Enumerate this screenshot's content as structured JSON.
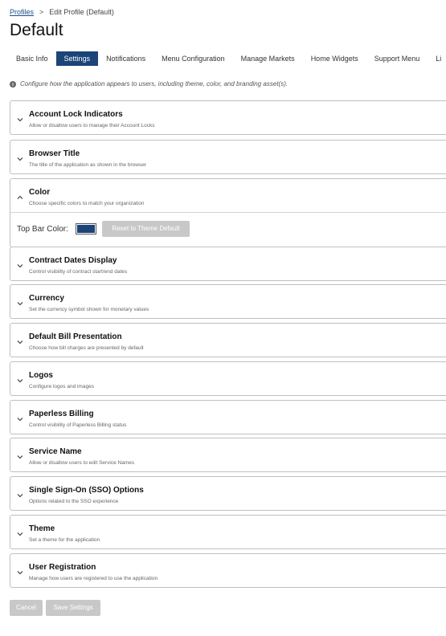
{
  "breadcrumb": {
    "root": "Profiles",
    "separator": ">",
    "current": "Edit Profile (Default)"
  },
  "title": "Default",
  "tabs": [
    {
      "label": "Basic Info",
      "active": false
    },
    {
      "label": "Settings",
      "active": true
    },
    {
      "label": "Notifications",
      "active": false
    },
    {
      "label": "Menu Configuration",
      "active": false
    },
    {
      "label": "Manage Markets",
      "active": false
    },
    {
      "label": "Home Widgets",
      "active": false
    },
    {
      "label": "Support Menu",
      "active": false
    },
    {
      "label": "Li",
      "active": false
    }
  ],
  "info_note": "Configure how the application appears to users, including theme, color, and branding asset(s).",
  "sections": [
    {
      "title": "Account Lock Indicators",
      "desc": "Allow or disallow users to manage their Account Locks",
      "expanded": false
    },
    {
      "title": "Browser Title",
      "desc": "The title of the application as shown in the browser",
      "expanded": false
    },
    {
      "title": "Color",
      "desc": "Choose specific colors to match your organization",
      "expanded": true
    },
    {
      "title": "Contract Dates Display",
      "desc": "Control visibility of contract start/end dates",
      "expanded": false
    },
    {
      "title": "Currency",
      "desc": "Set the currency symbol shown for monetary values",
      "expanded": false
    },
    {
      "title": "Default Bill Presentation",
      "desc": "Choose how bill charges are presented by default",
      "expanded": false
    },
    {
      "title": "Logos",
      "desc": "Configure logos and images",
      "expanded": false
    },
    {
      "title": "Paperless Billing",
      "desc": "Control visibility of Paperless Billing status",
      "expanded": false
    },
    {
      "title": "Service Name",
      "desc": "Allow or disallow users to edit Service Names",
      "expanded": false
    },
    {
      "title": "Single Sign-On (SSO) Options",
      "desc": "Options related to the SSO experience",
      "expanded": false
    },
    {
      "title": "Theme",
      "desc": "Set a theme for the application",
      "expanded": false
    },
    {
      "title": "User Registration",
      "desc": "Manage how users are registered to use the application",
      "expanded": false
    }
  ],
  "color_settings": {
    "label": "Top Bar Color:",
    "value": "#1b4478",
    "reset_label": "Reset to Theme Default"
  },
  "actions": {
    "cancel": "Cancel",
    "save": "Save Settings"
  },
  "colors": {
    "accent": "#1b4478",
    "link": "#1a4f8b",
    "disabled_button": "#c8c8c8",
    "border": "#bfbfbf"
  }
}
